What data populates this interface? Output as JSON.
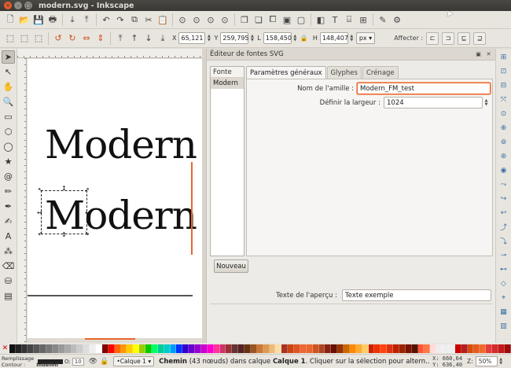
{
  "window": {
    "title": "modern.svg - Inkscape",
    "close_glyph": "×",
    "min_glyph": "–",
    "max_glyph": "□"
  },
  "toolbar_commands": [
    {
      "name": "new-document-icon",
      "glyph": "🗋"
    },
    {
      "name": "open-icon",
      "glyph": "📂"
    },
    {
      "name": "save-icon",
      "glyph": "💾"
    },
    {
      "name": "print-icon",
      "glyph": "🖶"
    },
    {
      "name": "import-icon",
      "glyph": "⤓"
    },
    {
      "name": "export-icon",
      "glyph": "⤒"
    },
    {
      "name": "undo-icon",
      "glyph": "↶"
    },
    {
      "name": "redo-icon",
      "glyph": "↷"
    },
    {
      "name": "copy-icon",
      "glyph": "⧉"
    },
    {
      "name": "cut-icon",
      "glyph": "✂"
    },
    {
      "name": "paste-icon",
      "glyph": "📋"
    },
    {
      "name": "zoom-selection-icon",
      "glyph": "⊙"
    },
    {
      "name": "zoom-drawing-icon",
      "glyph": "⊙"
    },
    {
      "name": "zoom-page-icon",
      "glyph": "⊙"
    },
    {
      "name": "zoom-width-icon",
      "glyph": "⊙"
    },
    {
      "name": "duplicate-icon",
      "glyph": "❐"
    },
    {
      "name": "clone-icon",
      "glyph": "❏"
    },
    {
      "name": "unlink-clone-icon",
      "glyph": "⧠"
    },
    {
      "name": "group-icon",
      "glyph": "▣"
    },
    {
      "name": "ungroup-icon",
      "glyph": "▢"
    },
    {
      "name": "fill-stroke-icon",
      "glyph": "◧"
    },
    {
      "name": "text-font-icon",
      "glyph": "T"
    },
    {
      "name": "xml-editor-icon",
      "glyph": "⌸"
    },
    {
      "name": "align-distribute-icon",
      "glyph": "⊞"
    },
    {
      "name": "preferences-icon",
      "glyph": "✎"
    },
    {
      "name": "document-properties-icon",
      "glyph": "⚙"
    }
  ],
  "selector_bar": {
    "x_label": "X",
    "x_value": "65,121",
    "y_label": "Y",
    "y_value": "259,795",
    "w_label": "L",
    "w_value": "158,450",
    "lock_glyph": "🔒",
    "h_label": "H",
    "h_value": "148,407",
    "unit": "px",
    "affect_label": "Affecter :"
  },
  "tools": [
    {
      "name": "selector-tool-icon",
      "glyph": "➤",
      "active": true
    },
    {
      "name": "node-tool-icon",
      "glyph": "↖"
    },
    {
      "name": "tweak-tool-icon",
      "glyph": "✋"
    },
    {
      "name": "zoom-tool-icon",
      "glyph": "🔍"
    },
    {
      "name": "rect-tool-icon",
      "glyph": "▭"
    },
    {
      "name": "3dbox-tool-icon",
      "glyph": "⬡"
    },
    {
      "name": "ellipse-tool-icon",
      "glyph": "◯"
    },
    {
      "name": "star-tool-icon",
      "glyph": "★"
    },
    {
      "name": "spiral-tool-icon",
      "glyph": "@"
    },
    {
      "name": "pencil-tool-icon",
      "glyph": "✏"
    },
    {
      "name": "pen-tool-icon",
      "glyph": "✒"
    },
    {
      "name": "calligraphy-tool-icon",
      "glyph": "✍"
    },
    {
      "name": "text-tool-icon",
      "glyph": "A"
    },
    {
      "name": "spray-tool-icon",
      "glyph": "⁂"
    },
    {
      "name": "eraser-tool-icon",
      "glyph": "⌫"
    },
    {
      "name": "bucket-tool-icon",
      "glyph": "⛁"
    },
    {
      "name": "gradient-tool-icon",
      "glyph": "▤"
    }
  ],
  "canvas": {
    "text_line_1": "Modern",
    "text_line_2": "Modern",
    "handle_glyph": "↕"
  },
  "font_editor": {
    "title": "Éditeur de fontes SVG",
    "header_buttons": [
      "▣",
      "✕"
    ],
    "font_list_header": "Fonte",
    "font_list_items": [
      "Modern"
    ],
    "new_button": "Nouveau",
    "tabs": [
      "Paramètres généraux",
      "Glyphes",
      "Crénage"
    ],
    "family_label": "Nom de l'amille :",
    "family_value": "Modern_FM_test",
    "width_label": "Définir la largeur :",
    "width_value": "1024",
    "preview_label": "Texte de l'aperçu :",
    "preview_value": "Texte exemple"
  },
  "commands_bar": [
    "⊞",
    "⊡",
    "⊟",
    "⤧",
    "⊙",
    "⊕",
    "⊚",
    "⊛",
    "◉",
    "⤳",
    "↪",
    "↩",
    "⤴",
    "⤵",
    "⊸",
    "⊷",
    "◇",
    "⌖",
    "▦",
    "▥"
  ],
  "palette": [
    "#111111",
    "#222222",
    "#333333",
    "#444444",
    "#555555",
    "#666666",
    "#777777",
    "#888888",
    "#999999",
    "#aaaaaa",
    "#bbbbbb",
    "#cccccc",
    "#dddddd",
    "#eeeeee",
    "#ffffff",
    "#800000",
    "#ff0000",
    "#ff6600",
    "#ff9900",
    "#ffcc00",
    "#ffff00",
    "#99cc00",
    "#00cc00",
    "#00ff66",
    "#00cc99",
    "#00cccc",
    "#0099ff",
    "#0033ff",
    "#3300cc",
    "#6600cc",
    "#9900cc",
    "#cc00cc",
    "#ff00cc",
    "#ff3399",
    "#cc3366",
    "#993333",
    "#663333",
    "#552222",
    "#663311",
    "#995522",
    "#cc7733",
    "#dd9955",
    "#eebb77",
    "#ffddaa",
    "#aa3322",
    "#cc4411",
    "#dd5522",
    "#ee6633",
    "#e8672d",
    "#cc5522",
    "#aa4422",
    "#882211",
    "#661100",
    "#993300",
    "#cc6600",
    "#ff8800",
    "#ffaa33",
    "#ffcc66",
    "#cc2200",
    "#ee3300",
    "#ff4411",
    "#dd3311",
    "#bb2200",
    "#992200",
    "#771100",
    "#551100",
    "#ff5533",
    "#ff7744",
    "#ffdddd",
    "#eeeeee",
    "#eeeeee",
    "#eeeeee",
    "#cc0000",
    "#b21f1f",
    "#d44d0d",
    "#e55c1c",
    "#f06b2b",
    "#e33c3c",
    "#d22b2b",
    "#c11a1a",
    "#a00909"
  ],
  "status": {
    "fill_label": "Remplissage :",
    "stroke_label": "Contour :",
    "stroke_value": "Indéfini",
    "opacity_label": "O:",
    "opacity_value": "10",
    "layer_name": "•Calque 1",
    "message_prefix": "Chemin",
    "message_mid": " (43 nœuds) dans calque ",
    "message_layer": "Calque 1",
    "message_suffix": ". Cliquer sur la sélection pour altern...",
    "x_coord": "X: 660,64",
    "y_coord": "Y: 636,40",
    "zoom_label": "Z:",
    "zoom_value": "50%"
  },
  "colors": {
    "accent": "#e8672d",
    "fill_swatch": "#222222",
    "stroke_swatch": "#ffffff"
  }
}
